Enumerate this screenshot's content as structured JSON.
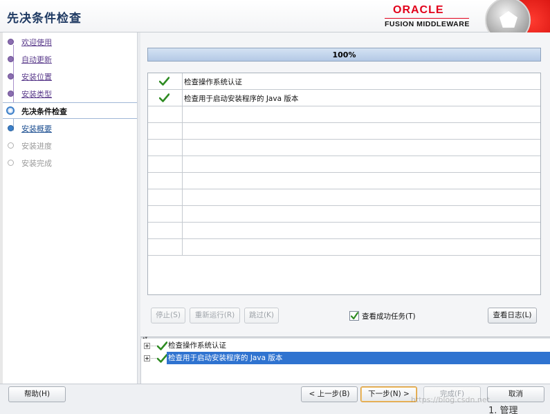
{
  "header": {
    "title": "先决条件检查",
    "brand": "ORACLE",
    "subbrand": "FUSION MIDDLEWARE"
  },
  "steps": [
    {
      "label": "欢迎使用",
      "state": "done"
    },
    {
      "label": "自动更新",
      "state": "done"
    },
    {
      "label": "安装位置",
      "state": "done"
    },
    {
      "label": "安装类型",
      "state": "done"
    },
    {
      "label": "先决条件检查",
      "state": "current"
    },
    {
      "label": "安装概要",
      "state": "next"
    },
    {
      "label": "安装进度",
      "state": "pending"
    },
    {
      "label": "安装完成",
      "state": "pending"
    }
  ],
  "progress": {
    "text": "100%",
    "value": 1.0
  },
  "checks": [
    {
      "status": "passed",
      "label": "检查操作系统认证"
    },
    {
      "status": "passed",
      "label": "检查用于启动安装程序的 Java 版本"
    }
  ],
  "actions": {
    "stop": "停止(S)",
    "rerun": "重新运行(R)",
    "skip": "跳过(K)",
    "view_success_tasks": "查看成功任务(T)",
    "view_success_checked": true,
    "view_log": "查看日志(L)"
  },
  "tree": [
    {
      "label": "检查操作系统认证",
      "selected": false
    },
    {
      "label": "检查用于启动安装程序的 Java 版本",
      "selected": true
    }
  ],
  "footer": {
    "help": "帮助(H)",
    "back": "< 上一步(B)",
    "next": "下一步(N) >",
    "finish": "完成(F)",
    "cancel": "取消"
  },
  "watermark": "https://blog.csdn.net",
  "corner_text": "1. 管理"
}
